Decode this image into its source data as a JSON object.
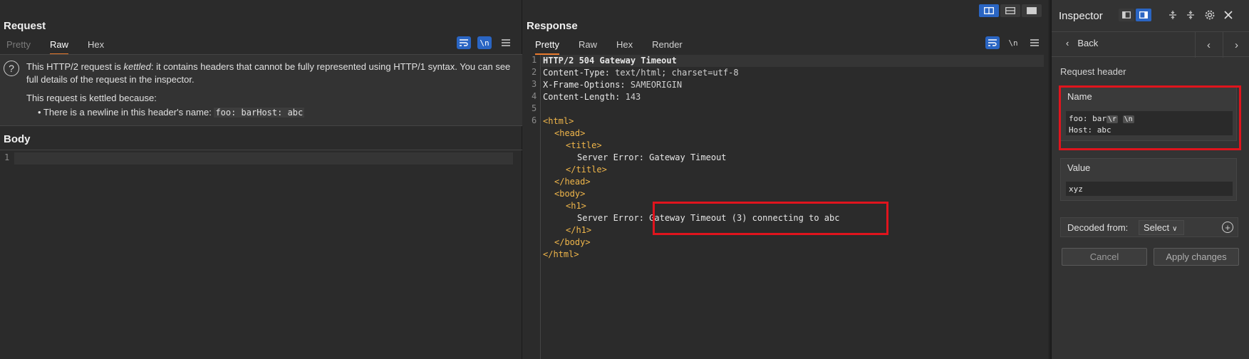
{
  "request": {
    "title": "Request",
    "tabs": [
      "Pretty",
      "Raw",
      "Hex"
    ],
    "active_tab": "Raw",
    "toolbar": {
      "wrap_icon": "word-wrap-icon",
      "newline_label": "\\n",
      "menu_icon": "hamburger-menu-icon"
    },
    "kettle_notice": {
      "text_before": "This HTTP/2 request is ",
      "text_italic": "kettled",
      "text_after": ": it contains headers that cannot be fully represented using HTTP/1 syntax. You can see full details of the request in the inspector.",
      "reason_title": "This request is kettled because:",
      "bullet_prefix": "• There is a newline in this header's name: ",
      "bullet_code": "foo: barHost: abc"
    },
    "body_title": "Body",
    "body_line_number": "1"
  },
  "response": {
    "title": "Response",
    "tabs": [
      "Pretty",
      "Raw",
      "Hex",
      "Render"
    ],
    "active_tab": "Pretty",
    "toolbar": {
      "wrap_icon": "word-wrap-icon",
      "newline_label": "\\n",
      "menu_icon": "hamburger-menu-icon"
    },
    "line_numbers": [
      "1",
      "2",
      "3",
      "4",
      "5",
      "6"
    ],
    "lines": {
      "l1": "HTTP/2 504 Gateway Timeout",
      "l2_name": "Content-Type:",
      "l2_val": " text/html; charset=utf-8",
      "l3_name": "X-Frame-Options:",
      "l3_val": " SAMEORIGIN",
      "l4_name": "Content-Length:",
      "l4_val": " 143",
      "html_open": "<html>",
      "head_open": "<head>",
      "title_open": "<title>",
      "title_text": "Server Error: Gateway Timeout",
      "title_close": "</title>",
      "head_close": "</head>",
      "body_open": "<body>",
      "h1_open": "<h1>",
      "h1_text": "Server Error: Gateway Timeout (3) connecting to abc",
      "h1_close": "</h1>",
      "body_close": "</body>",
      "html_close": "</html>"
    }
  },
  "inspector": {
    "title": "Inspector",
    "back_label": "Back",
    "section_label": "Request header",
    "name_label": "Name",
    "name_line1": "foo: bar",
    "name_esc1": "\\r",
    "name_esc2": "\\n",
    "name_line2": "Host: abc",
    "value_label": "Value",
    "value_text": "xyz",
    "decoded_label": "Decoded from:",
    "decoded_select": "Select",
    "cancel_label": "Cancel",
    "apply_label": "Apply changes"
  },
  "colors": {
    "accent_tab": "#e8792d",
    "highlight_red": "#e0141d",
    "toolbar_blue": "#2a65c3",
    "tag_orange": "#f0b64a"
  }
}
